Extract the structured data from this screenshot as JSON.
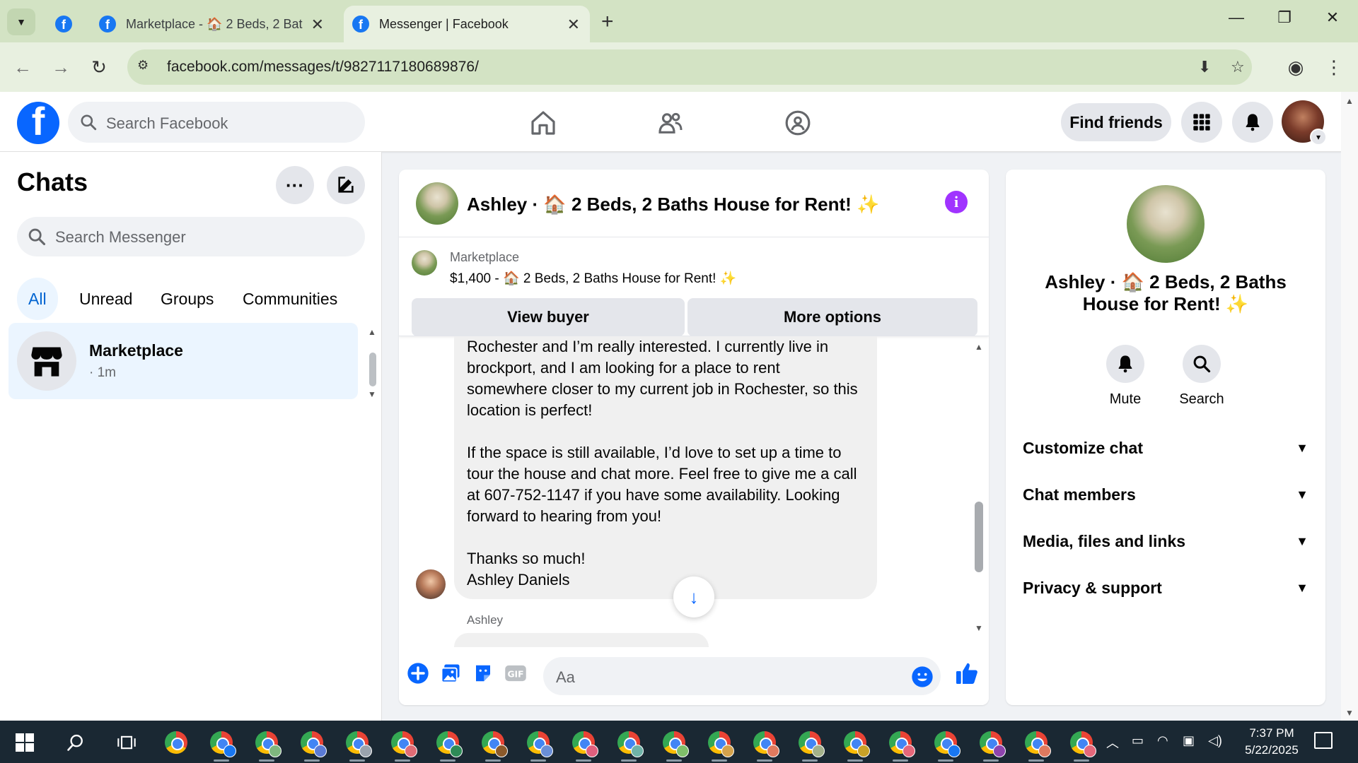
{
  "browser": {
    "tabs": [
      {
        "title": "Marketplace - 🏠 2 Beds, 2 Bat",
        "active": false
      },
      {
        "title": "Messenger | Facebook",
        "active": true
      }
    ],
    "url": "facebook.com/messages/t/9827117180689876/"
  },
  "header": {
    "search_placeholder": "Search Facebook",
    "find_friends": "Find friends"
  },
  "chats": {
    "title": "Chats",
    "search_placeholder": "Search Messenger",
    "filters": [
      "All",
      "Unread",
      "Groups",
      "Communities"
    ],
    "active_filter": "All",
    "items": [
      {
        "name": "Marketplace",
        "time": "· 1m"
      }
    ]
  },
  "conversation": {
    "title": "Ashley · 🏠 2 Beds, 2 Baths House for Rent! ✨",
    "banner": {
      "label": "Marketplace",
      "price_line": "$1,400 - 🏠 2 Beds, 2 Baths House for Rent! ✨",
      "view_buyer": "View buyer",
      "more_options": "More options"
    },
    "message_lines": [
      "Rochester and I’m really interested. I currently live in",
      "brockport, and I am looking for a place to rent",
      "somewhere closer to my current job in Rochester, so this",
      "location is perfect!",
      "",
      "If the space is still available, I’d love to set up a time to",
      "tour the house and chat more. Feel free to give me a call",
      "at 607-752-1147 if you have some availability. Looking",
      "forward to hearing from you!",
      "",
      "Thanks so much!",
      "Ashley Daniels"
    ],
    "next_sender": "Ashley",
    "composer_placeholder": "Aa"
  },
  "info_panel": {
    "title": "Ashley · 🏠 2 Beds, 2 Baths House for Rent! ✨",
    "actions": [
      {
        "label": "Mute",
        "icon": "bell-icon"
      },
      {
        "label": "Search",
        "icon": "search-icon"
      }
    ],
    "sections": [
      "Customize chat",
      "Chat members",
      "Media, files and links",
      "Privacy & support"
    ]
  },
  "taskbar": {
    "time": "7:37 PM",
    "date": "5/22/2025"
  },
  "colors": {
    "fb_blue": "#0866ff",
    "messenger_purple": "#a033ff",
    "chrome_tab_green": "#d3e3c4"
  }
}
